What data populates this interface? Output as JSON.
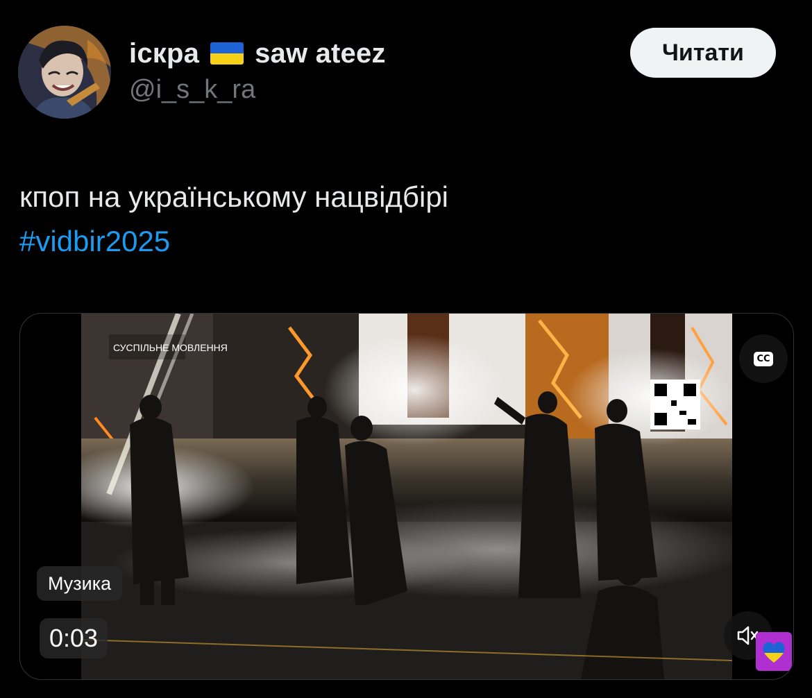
{
  "tweet": {
    "author": {
      "display_name": "іскра",
      "display_name_suffix": "saw ateez",
      "flag_icon": "ukraine-flag-icon",
      "handle": "@i_s_k_ra"
    },
    "follow_button_label": "Читати",
    "text": "кпоп на українському нацвідбірі",
    "hashtag": "#vidbir2025",
    "media": {
      "type": "video",
      "music_badge": "Музика",
      "timestamp": "0:03",
      "captions_button": "CC",
      "captions_icon": "closed-captions-icon",
      "mute_icon": "speaker-muted-icon",
      "channel_overlay": "СУСПІЛЬНЕ МОВЛЕННЯ"
    }
  },
  "colors": {
    "background": "#000000",
    "text_primary": "#e7e9ea",
    "text_secondary": "#71767b",
    "link": "#1d9bf0",
    "button_bg": "#eff3f4",
    "button_text": "#0f1419",
    "flag_blue": "#1e63d6",
    "flag_yellow": "#f7d117"
  }
}
